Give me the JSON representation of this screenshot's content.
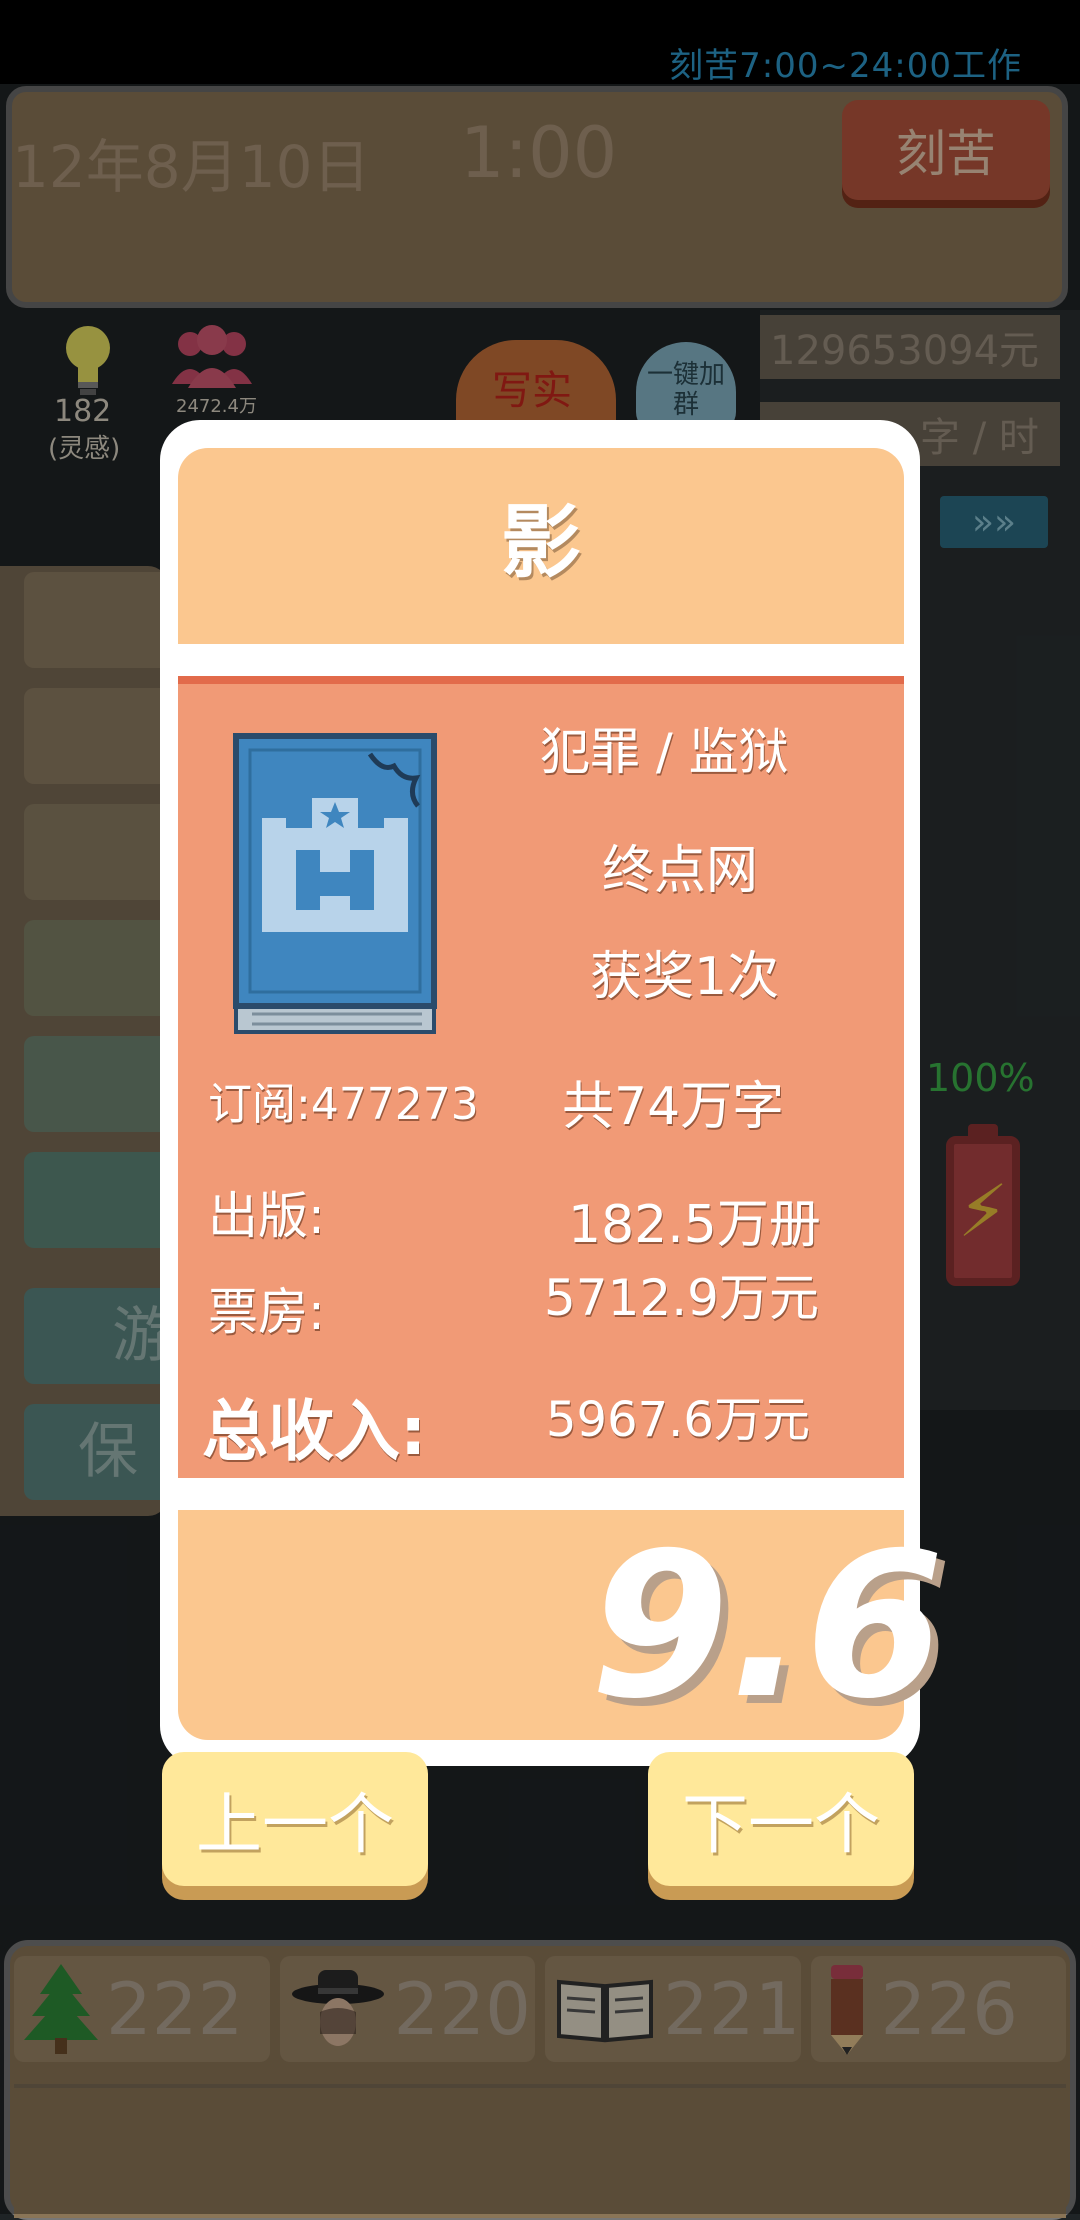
{
  "header": {
    "work_hint": "刻苦7:00~24:00工作",
    "date": "12年8月10日",
    "time": "1:00",
    "work_button": "刻苦"
  },
  "background": {
    "money": "129653094元",
    "speed": "字 / 时",
    "inspiration_value": "182",
    "inspiration_label": "(灵感)",
    "fans_value": "2472.4万",
    "write_label": "写实",
    "join_group": "一键加群",
    "battery_percent": "100%",
    "left_rows": [
      "游",
      "保"
    ]
  },
  "book": {
    "title": "影",
    "genre": "犯罪 / 监狱",
    "platform": "终点网",
    "awards": "获奖1次",
    "subscriptions": "订阅:477273",
    "word_count": "共74万字",
    "published_label": "出版:",
    "published_value": "182.5万册",
    "boxoffice_label": "票房:",
    "boxoffice_value": "5712.9万元",
    "income_label": "总收入:",
    "income_value": "5967.6万元",
    "score": "9.6"
  },
  "nav": {
    "prev": "上一个",
    "next": "下一个"
  },
  "stats": [
    {
      "icon": "tree-icon",
      "value": "222"
    },
    {
      "icon": "detective-icon",
      "value": "220"
    },
    {
      "icon": "book-icon",
      "value": "221"
    },
    {
      "icon": "pencil-icon",
      "value": "226"
    }
  ],
  "colors": {
    "card_header": "#fbc78f",
    "card_body": "#f19a76",
    "nav_button": "#ffe89a",
    "work_button": "#b5553e",
    "hint_blue": "#2d97c9"
  }
}
